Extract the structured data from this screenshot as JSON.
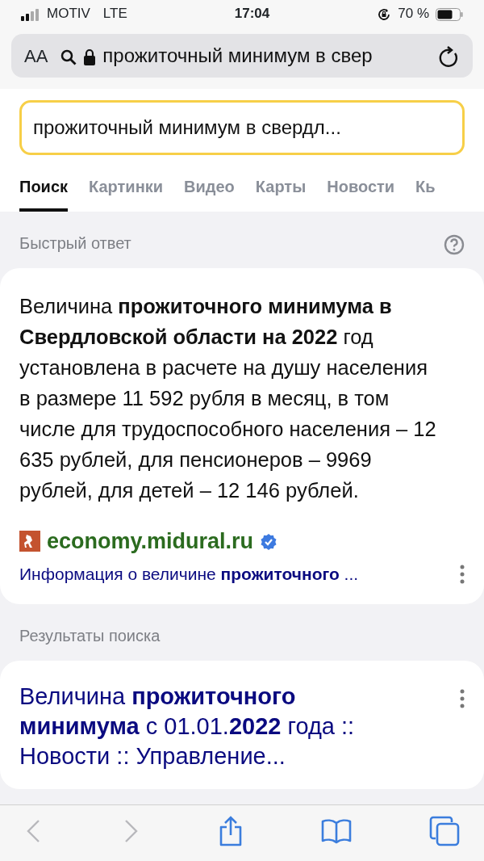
{
  "status_bar": {
    "carrier": "MOTIV",
    "network": "LTE",
    "time": "17:04",
    "battery": "70 %"
  },
  "address_bar": {
    "text_size": "AA",
    "url": "прожиточный минимум в свер"
  },
  "search": {
    "value": "прожиточный минимум в свердл..."
  },
  "tabs": [
    {
      "label": "Поиск",
      "selected": true
    },
    {
      "label": "Картинки",
      "selected": false
    },
    {
      "label": "Видео",
      "selected": false
    },
    {
      "label": "Карты",
      "selected": false
    },
    {
      "label": "Новости",
      "selected": false
    },
    {
      "label": "Кь",
      "selected": false
    }
  ],
  "quick_answer": {
    "heading": "Быстрый ответ",
    "text": "Величина **прожиточного минимума в Свердловской области на 2022** год установлена в расчете на душу населения в размере 11 592 рубля в месяц, в том числе для трудоспособного населения – 12 635 рублей, для пенсионеров – 9969 рублей, для детей – 12 146 рублей.",
    "source": "economy.midural.ru",
    "verified": true,
    "link": "Информация о величине **прожиточного** ..."
  },
  "results": {
    "heading": "Результаты поиска",
    "items": [
      {
        "title": "Величина **прожиточного минимума** с 01.01.**2022** года :: Новости :: Управление..."
      }
    ]
  },
  "toolbar": {
    "back_disabled": true,
    "forward_disabled": true
  }
}
